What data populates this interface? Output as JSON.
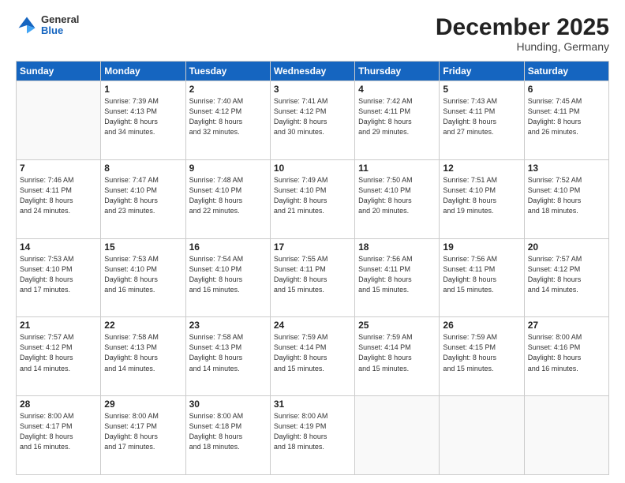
{
  "logo": {
    "general": "General",
    "blue": "Blue"
  },
  "header": {
    "month": "December 2025",
    "location": "Hunding, Germany"
  },
  "weekdays": [
    "Sunday",
    "Monday",
    "Tuesday",
    "Wednesday",
    "Thursday",
    "Friday",
    "Saturday"
  ],
  "weeks": [
    [
      {
        "day": "",
        "info": ""
      },
      {
        "day": "1",
        "info": "Sunrise: 7:39 AM\nSunset: 4:13 PM\nDaylight: 8 hours\nand 34 minutes."
      },
      {
        "day": "2",
        "info": "Sunrise: 7:40 AM\nSunset: 4:12 PM\nDaylight: 8 hours\nand 32 minutes."
      },
      {
        "day": "3",
        "info": "Sunrise: 7:41 AM\nSunset: 4:12 PM\nDaylight: 8 hours\nand 30 minutes."
      },
      {
        "day": "4",
        "info": "Sunrise: 7:42 AM\nSunset: 4:11 PM\nDaylight: 8 hours\nand 29 minutes."
      },
      {
        "day": "5",
        "info": "Sunrise: 7:43 AM\nSunset: 4:11 PM\nDaylight: 8 hours\nand 27 minutes."
      },
      {
        "day": "6",
        "info": "Sunrise: 7:45 AM\nSunset: 4:11 PM\nDaylight: 8 hours\nand 26 minutes."
      }
    ],
    [
      {
        "day": "7",
        "info": "Sunrise: 7:46 AM\nSunset: 4:11 PM\nDaylight: 8 hours\nand 24 minutes."
      },
      {
        "day": "8",
        "info": "Sunrise: 7:47 AM\nSunset: 4:10 PM\nDaylight: 8 hours\nand 23 minutes."
      },
      {
        "day": "9",
        "info": "Sunrise: 7:48 AM\nSunset: 4:10 PM\nDaylight: 8 hours\nand 22 minutes."
      },
      {
        "day": "10",
        "info": "Sunrise: 7:49 AM\nSunset: 4:10 PM\nDaylight: 8 hours\nand 21 minutes."
      },
      {
        "day": "11",
        "info": "Sunrise: 7:50 AM\nSunset: 4:10 PM\nDaylight: 8 hours\nand 20 minutes."
      },
      {
        "day": "12",
        "info": "Sunrise: 7:51 AM\nSunset: 4:10 PM\nDaylight: 8 hours\nand 19 minutes."
      },
      {
        "day": "13",
        "info": "Sunrise: 7:52 AM\nSunset: 4:10 PM\nDaylight: 8 hours\nand 18 minutes."
      }
    ],
    [
      {
        "day": "14",
        "info": "Sunrise: 7:53 AM\nSunset: 4:10 PM\nDaylight: 8 hours\nand 17 minutes."
      },
      {
        "day": "15",
        "info": "Sunrise: 7:53 AM\nSunset: 4:10 PM\nDaylight: 8 hours\nand 16 minutes."
      },
      {
        "day": "16",
        "info": "Sunrise: 7:54 AM\nSunset: 4:10 PM\nDaylight: 8 hours\nand 16 minutes."
      },
      {
        "day": "17",
        "info": "Sunrise: 7:55 AM\nSunset: 4:11 PM\nDaylight: 8 hours\nand 15 minutes."
      },
      {
        "day": "18",
        "info": "Sunrise: 7:56 AM\nSunset: 4:11 PM\nDaylight: 8 hours\nand 15 minutes."
      },
      {
        "day": "19",
        "info": "Sunrise: 7:56 AM\nSunset: 4:11 PM\nDaylight: 8 hours\nand 15 minutes."
      },
      {
        "day": "20",
        "info": "Sunrise: 7:57 AM\nSunset: 4:12 PM\nDaylight: 8 hours\nand 14 minutes."
      }
    ],
    [
      {
        "day": "21",
        "info": "Sunrise: 7:57 AM\nSunset: 4:12 PM\nDaylight: 8 hours\nand 14 minutes."
      },
      {
        "day": "22",
        "info": "Sunrise: 7:58 AM\nSunset: 4:13 PM\nDaylight: 8 hours\nand 14 minutes."
      },
      {
        "day": "23",
        "info": "Sunrise: 7:58 AM\nSunset: 4:13 PM\nDaylight: 8 hours\nand 14 minutes."
      },
      {
        "day": "24",
        "info": "Sunrise: 7:59 AM\nSunset: 4:14 PM\nDaylight: 8 hours\nand 15 minutes."
      },
      {
        "day": "25",
        "info": "Sunrise: 7:59 AM\nSunset: 4:14 PM\nDaylight: 8 hours\nand 15 minutes."
      },
      {
        "day": "26",
        "info": "Sunrise: 7:59 AM\nSunset: 4:15 PM\nDaylight: 8 hours\nand 15 minutes."
      },
      {
        "day": "27",
        "info": "Sunrise: 8:00 AM\nSunset: 4:16 PM\nDaylight: 8 hours\nand 16 minutes."
      }
    ],
    [
      {
        "day": "28",
        "info": "Sunrise: 8:00 AM\nSunset: 4:17 PM\nDaylight: 8 hours\nand 16 minutes."
      },
      {
        "day": "29",
        "info": "Sunrise: 8:00 AM\nSunset: 4:17 PM\nDaylight: 8 hours\nand 17 minutes."
      },
      {
        "day": "30",
        "info": "Sunrise: 8:00 AM\nSunset: 4:18 PM\nDaylight: 8 hours\nand 18 minutes."
      },
      {
        "day": "31",
        "info": "Sunrise: 8:00 AM\nSunset: 4:19 PM\nDaylight: 8 hours\nand 18 minutes."
      },
      {
        "day": "",
        "info": ""
      },
      {
        "day": "",
        "info": ""
      },
      {
        "day": "",
        "info": ""
      }
    ]
  ]
}
